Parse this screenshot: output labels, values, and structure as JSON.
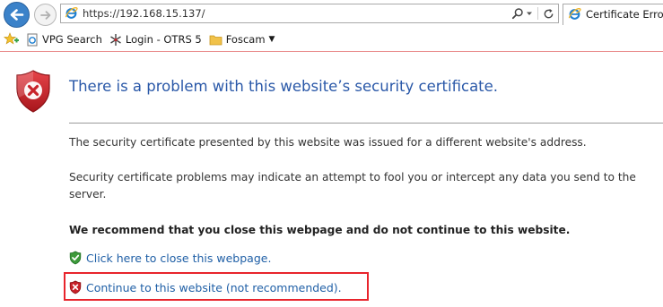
{
  "browser": {
    "address_url": "https://192.168.15.137/",
    "tab_title": "Certificate Error:",
    "icons": {
      "back": "back-arrow-icon",
      "forward": "forward-arrow-icon",
      "address_site": "ie-logo-icon",
      "search": "search-icon",
      "dropdown": "chevron-down-icon",
      "refresh": "refresh-icon"
    }
  },
  "favorites": {
    "items": [
      {
        "label": "VPG Search",
        "icon": "page-icon"
      },
      {
        "label": "Login - OTRS 5",
        "icon": "otrs-icon"
      },
      {
        "label": "Foscam",
        "icon": "folder-icon"
      }
    ]
  },
  "content": {
    "title": "There is a problem with this website’s security certificate.",
    "paragraph1": "The security certificate presented by this website was issued for a different website's address.",
    "paragraph2": "Security certificate problems may indicate an attempt to fool you or intercept any data you send to the server.",
    "recommendation": "We recommend that you close this webpage and do not continue to this website.",
    "close_link": "Click here to close this webpage.",
    "continue_link": "Continue to this website (not recommended)."
  },
  "colors": {
    "title": "#2a58a8",
    "link": "#1f5fa6",
    "highlight": "#e8242c",
    "error_shield": "#c8232a",
    "ok_shield": "#3d9a3a"
  }
}
